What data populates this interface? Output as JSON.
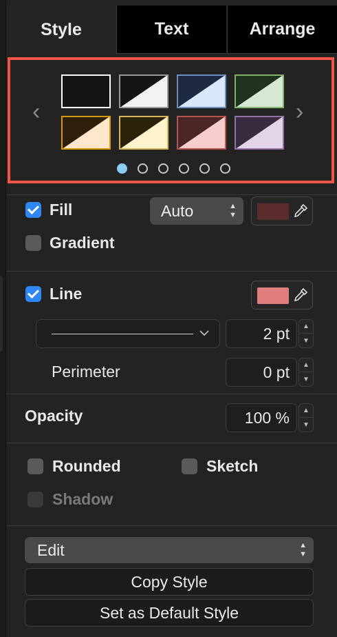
{
  "tabs": {
    "style": "Style",
    "text": "Text",
    "arrange": "Arrange"
  },
  "swatches": [
    {
      "border": "#ffffff",
      "top": "#151515",
      "bottom": "#151515"
    },
    {
      "border": "#9a9a9a",
      "top": "#151515",
      "bottom": "#f2f2f2"
    },
    {
      "border": "#6c8ebf",
      "top": "#1d2a42",
      "bottom": "#dae8fc"
    },
    {
      "border": "#82b366",
      "top": "#1f3320",
      "bottom": "#d5e8d4"
    },
    {
      "border": "#d79b00",
      "top": "#2e1f0b",
      "bottom": "#ffe6cc"
    },
    {
      "border": "#d6b656",
      "top": "#2a2308",
      "bottom": "#fff2cc"
    },
    {
      "border": "#b85450",
      "top": "#4a2626",
      "bottom": "#f8cecc"
    },
    {
      "border": "#9673a6",
      "top": "#3a2c40",
      "bottom": "#e1d5e7"
    }
  ],
  "pager": {
    "pages": 6,
    "active": 0
  },
  "fill": {
    "label": "Fill",
    "checked": true,
    "mode": "Auto",
    "color": "#5a2c2c"
  },
  "gradient": {
    "label": "Gradient",
    "checked": false
  },
  "line": {
    "label": "Line",
    "checked": true,
    "color": "#e07e7e",
    "width": "2 pt"
  },
  "perimeter": {
    "label": "Perimeter",
    "value": "0 pt"
  },
  "opacity": {
    "label": "Opacity",
    "value": "100 %"
  },
  "rounded": {
    "label": "Rounded",
    "checked": false
  },
  "sketch": {
    "label": "Sketch",
    "checked": false
  },
  "shadow": {
    "label": "Shadow",
    "checked": false,
    "disabled": true
  },
  "edit": {
    "label": "Edit"
  },
  "buttons": {
    "copy": "Copy Style",
    "default": "Set as Default Style"
  },
  "accent": "#2f86f5",
  "highlight": "#f05548"
}
